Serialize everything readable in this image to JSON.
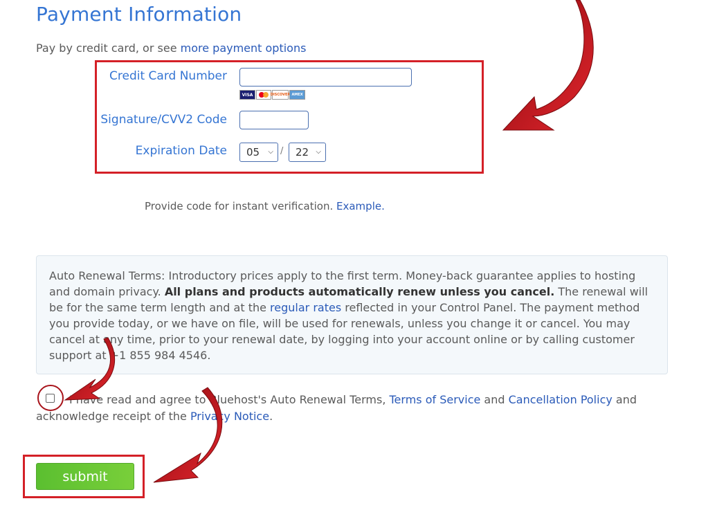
{
  "page": {
    "title": "Payment Information",
    "pay_prefix": "Pay by credit card, or see ",
    "pay_link": "more payment options"
  },
  "card_form": {
    "cc_label": "Credit Card Number",
    "cc_value": "",
    "cvv_label": "Signature/CVV2 Code",
    "cvv_value": "",
    "exp_label": "Expiration Date",
    "exp_month": "05",
    "exp_year": "22",
    "exp_separator": "/",
    "cards": [
      "VISA",
      "MC",
      "DISCOVER",
      "AMEX"
    ]
  },
  "verification": {
    "text": "Provide code for instant verification. ",
    "link": "Example."
  },
  "terms": {
    "p1": "Auto Renewal Terms: Introductory prices apply to the first term. Money-back guarantee applies to hosting and domain privacy. ",
    "bold": "All plans and products automatically renew unless you cancel.",
    "p2": " The renewal will be for the same term length and at the ",
    "link": "regular rates",
    "p3": " reflected in your Control Panel. The payment method you provide today, or we have on file, will be used for renewals, unless you change it or cancel. You may cancel at any time, prior to your renewal date, by logging into your account online or by calling customer support at +1 855 984 4546."
  },
  "agreement": {
    "t1": "I have read and agree to Bluehost's Auto Renewal Terms, ",
    "tos": "Terms of Service",
    "t2": " and ",
    "cancel": "Cancellation Policy",
    "t3": " and acknowledge receipt of the ",
    "privacy": "Privacy Notice",
    "t4": ".",
    "checked": false
  },
  "submit_label": "submit",
  "colors": {
    "accent_blue": "#3575d3",
    "link_blue": "#2a5ab8",
    "highlight_red": "#d42027",
    "submit_green": "#6ac733"
  }
}
